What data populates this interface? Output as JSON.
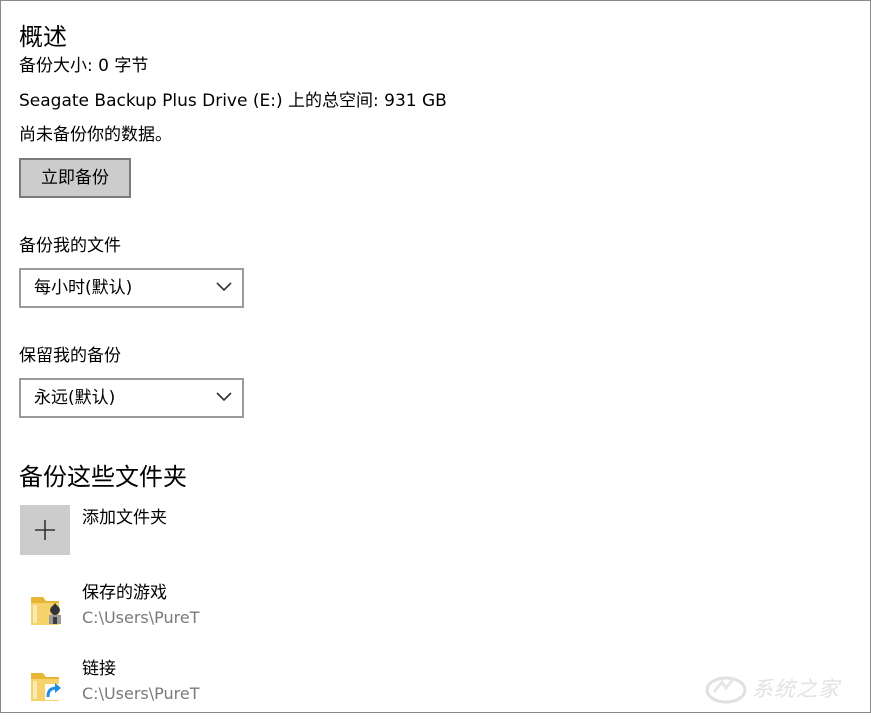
{
  "overview": {
    "title": "概述",
    "backup_size": "备份大小: 0 字节",
    "total_space": "Seagate Backup Plus Drive (E:) 上的总空间: 931 GB",
    "status": "尚未备份你的数据。",
    "backup_now_label": "立即备份"
  },
  "backup_frequency": {
    "label": "备份我的文件",
    "selected": "每小时(默认)"
  },
  "keep_backups": {
    "label": "保留我的备份",
    "selected": "永远(默认)"
  },
  "folders_section": {
    "title": "备份这些文件夹",
    "add_folder_label": "添加文件夹",
    "folders": [
      {
        "name": "保存的游戏",
        "path": "C:\\Users\\PureT",
        "icon": "saved-games-folder-icon"
      },
      {
        "name": "链接",
        "path": "C:\\Users\\PureT",
        "icon": "links-folder-icon"
      }
    ]
  },
  "watermark": {
    "text": "系统之家"
  },
  "colors": {
    "button_bg": "#cccccc",
    "secondary_text": "#7a7a7a",
    "folder_yellow": "#f3c94b",
    "link_arrow_blue": "#1e8fe0"
  }
}
